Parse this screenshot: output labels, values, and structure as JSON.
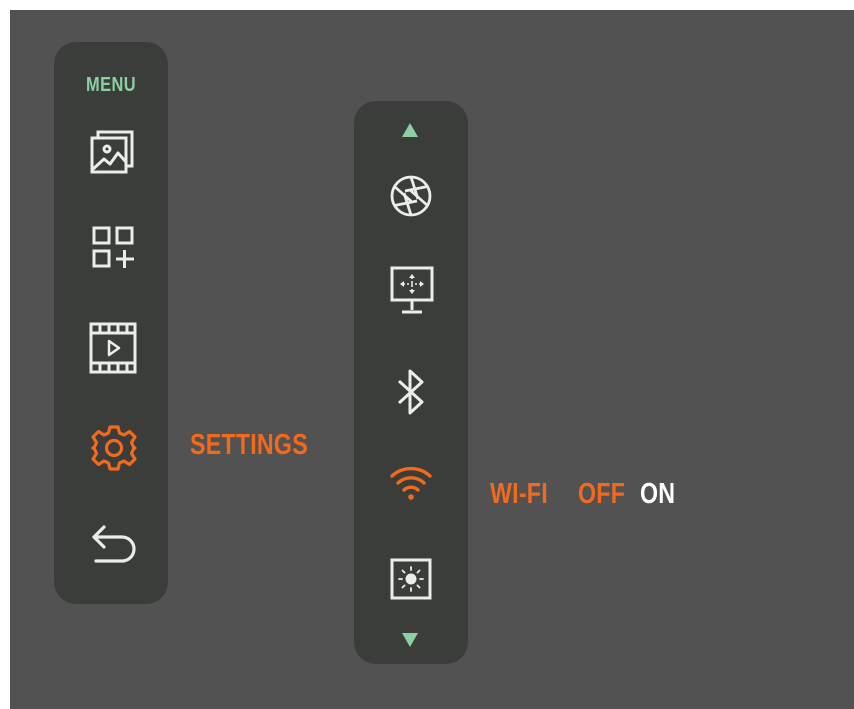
{
  "menu": {
    "title": "MENU",
    "items": [
      {
        "name": "gallery",
        "icon": "gallery-icon"
      },
      {
        "name": "apps",
        "icon": "add-apps-icon"
      },
      {
        "name": "video",
        "icon": "video-film-icon"
      },
      {
        "name": "settings",
        "icon": "gear-icon",
        "active": true
      },
      {
        "name": "back",
        "icon": "return-arrow-icon"
      }
    ],
    "active_label": "SETTINGS"
  },
  "settings_menu": {
    "items": [
      {
        "name": "aperture",
        "icon": "aperture-icon"
      },
      {
        "name": "display",
        "icon": "monitor-move-icon"
      },
      {
        "name": "bluetooth",
        "icon": "bluetooth-icon"
      },
      {
        "name": "wifi",
        "icon": "wifi-icon",
        "active": true
      },
      {
        "name": "brightness",
        "icon": "brightness-icon"
      }
    ],
    "active_label": "WI-FI",
    "option_off": "OFF",
    "option_on": "ON"
  },
  "colors": {
    "accent": "#f26a1b",
    "menu_title": "#8ccfa3",
    "icon": "#e8eee8",
    "panel": "#3b3d3b",
    "background": "#525252"
  }
}
